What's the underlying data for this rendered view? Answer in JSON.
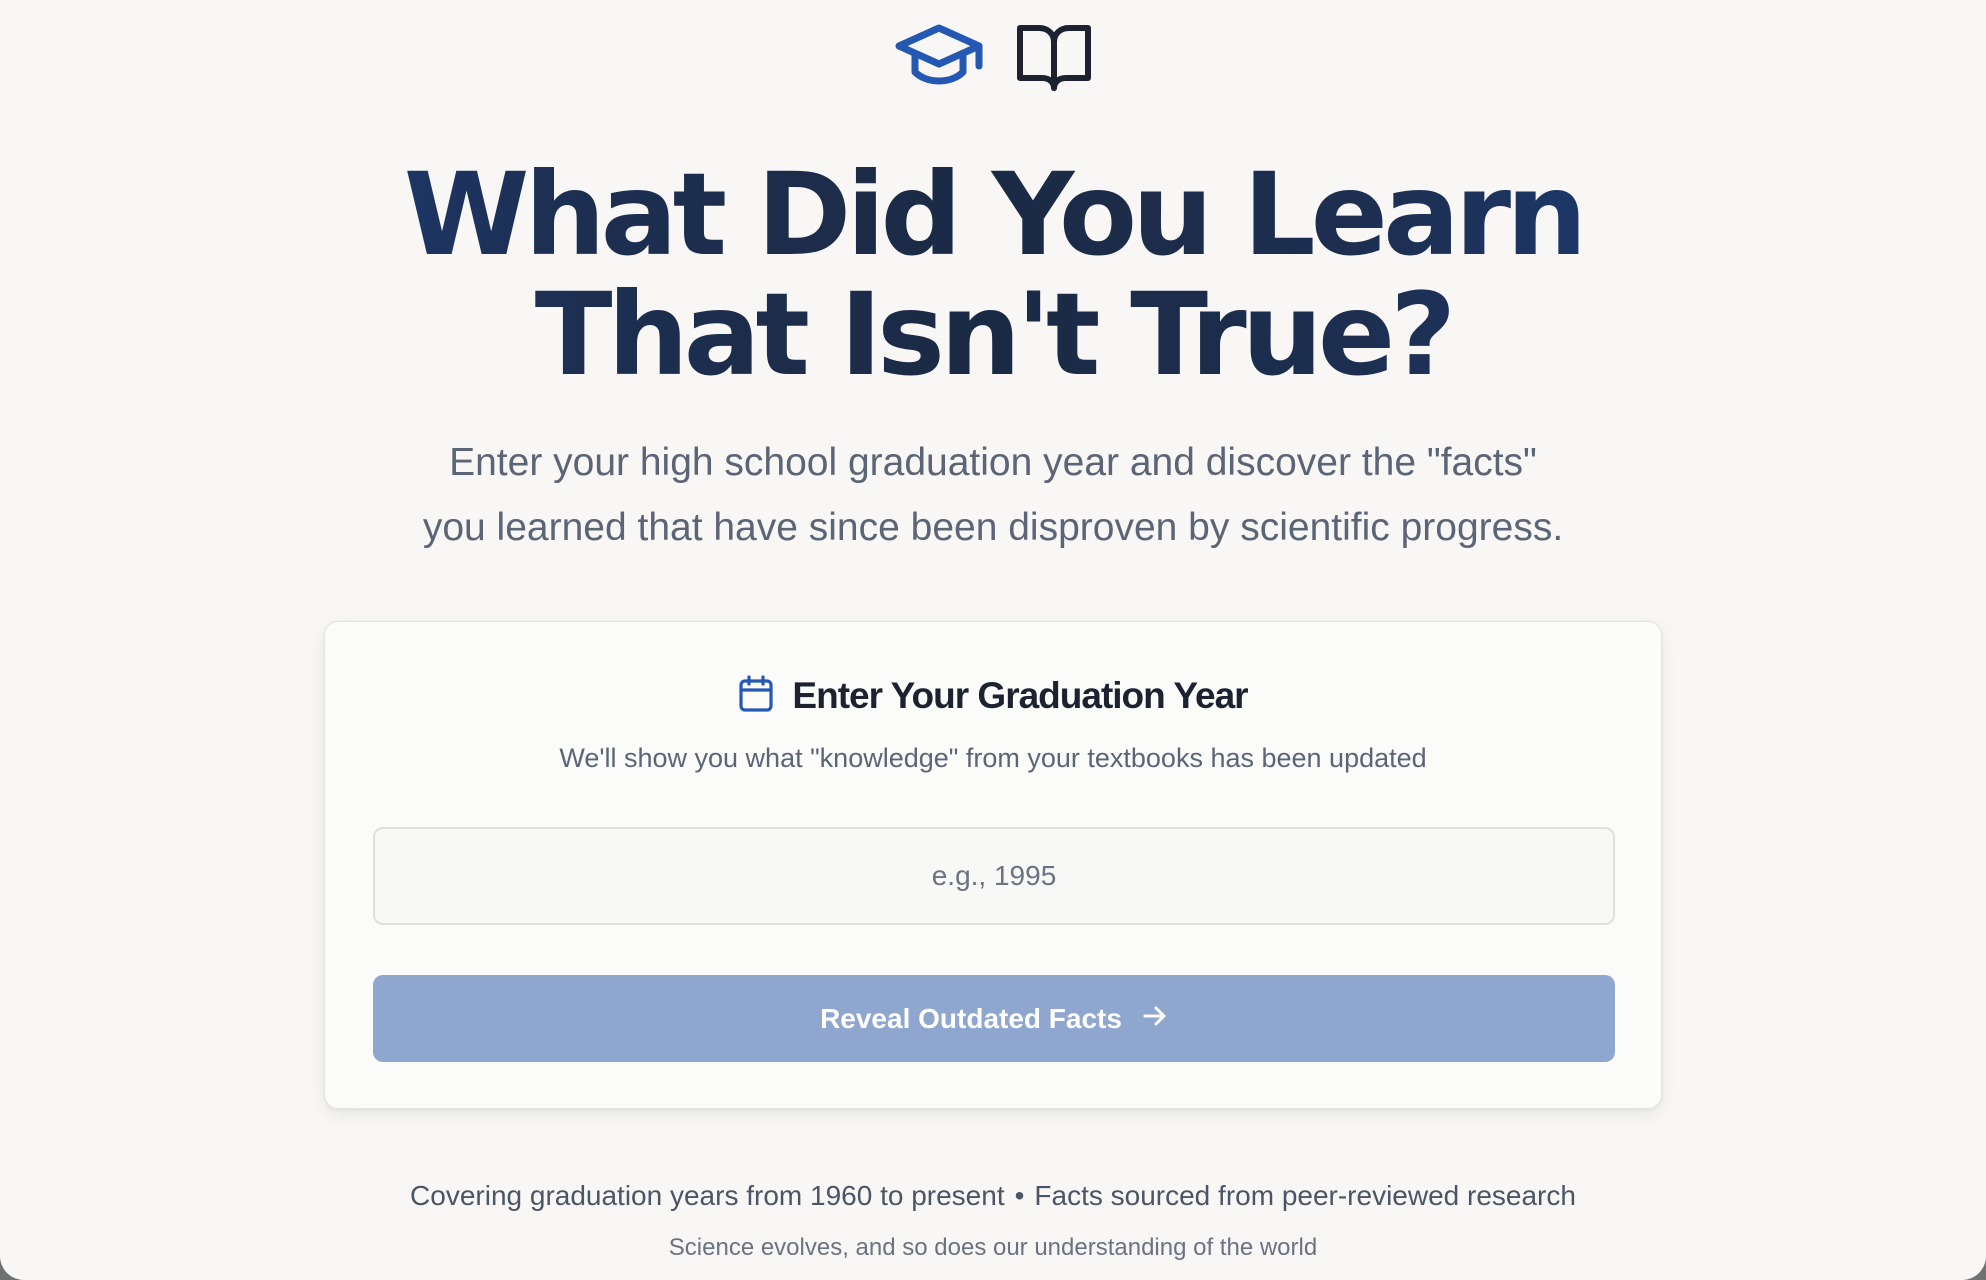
{
  "header": {
    "icons": [
      "graduation-cap-icon",
      "open-book-icon"
    ],
    "icon_colors": {
      "graduation_cap": "#2458b3",
      "book": "#1c2230"
    },
    "title_line1": "What Did You Learn",
    "title_line2": "That Isn't True?",
    "title_gradient": [
      "#1e4795",
      "#1b2a44"
    ],
    "subtitle_line1": "Enter your high school graduation year and discover the \"facts\"",
    "subtitle_line2": "you learned that have since been disproven by scientific progress."
  },
  "card": {
    "icon": "calendar-icon",
    "title": "Enter Your Graduation Year",
    "description": "We'll show you what \"knowledge\" from your textbooks has been updated",
    "input": {
      "placeholder": "e.g., 1995",
      "value": ""
    },
    "button": {
      "label": "Reveal Outdated Facts",
      "icon": "arrow-right-icon",
      "color": "#8fa6cf"
    }
  },
  "footer": {
    "left": "Covering graduation years from 1960 to present",
    "separator": "•",
    "right": "Facts sourced from peer-reviewed research",
    "tagline": "Science evolves, and so does our understanding of the world"
  }
}
